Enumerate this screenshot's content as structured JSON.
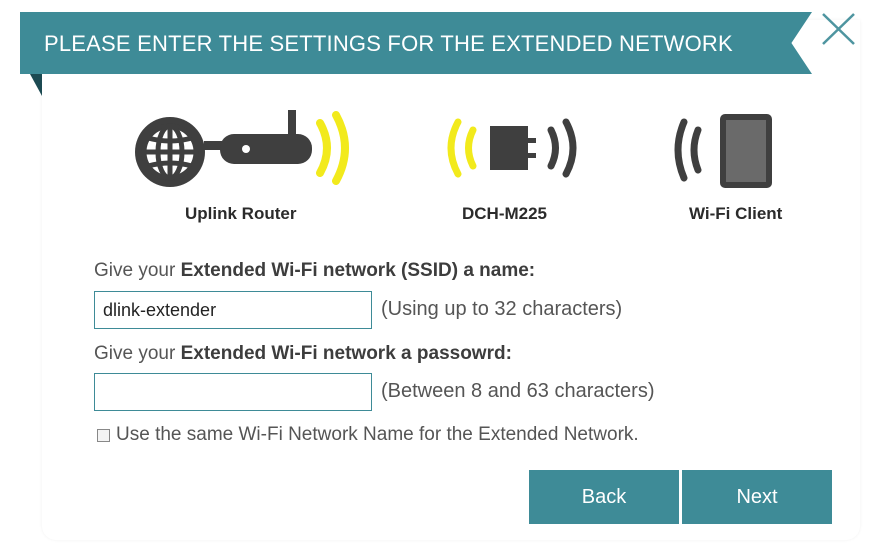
{
  "header": {
    "title": "PLEASE ENTER THE SETTINGS FOR THE EXTENDED NETWORK",
    "close_icon": "close-icon"
  },
  "diagram": {
    "devices": [
      {
        "label": "Uplink Router",
        "icon": "uplink-router-icon"
      },
      {
        "label": "DCH-M225",
        "icon": "extender-icon"
      },
      {
        "label": "Wi-Fi Client",
        "icon": "tablet-icon"
      }
    ],
    "colors": {
      "signal_active": "#f2ea1c",
      "device": "#3f3f3f"
    }
  },
  "form": {
    "ssid_prompt_prefix": "Give your ",
    "ssid_prompt_bold": "Extended Wi-Fi network (SSID) a name:",
    "ssid_value": "dlink-extender",
    "ssid_hint": "(Using up to 32 characters)",
    "password_prompt_prefix": "Give your ",
    "password_prompt_bold": "Extended Wi-Fi network a passowrd:",
    "password_value": "",
    "password_hint": "(Between 8 and 63 characters)",
    "same_name_checkbox_label": "Use the same Wi-Fi Network Name for the Extended Network.",
    "same_name_checked": false
  },
  "buttons": {
    "back_label": "Back",
    "next_label": "Next"
  },
  "colors": {
    "accent": "#3e8b97",
    "accent_dark": "#1c4a52"
  }
}
